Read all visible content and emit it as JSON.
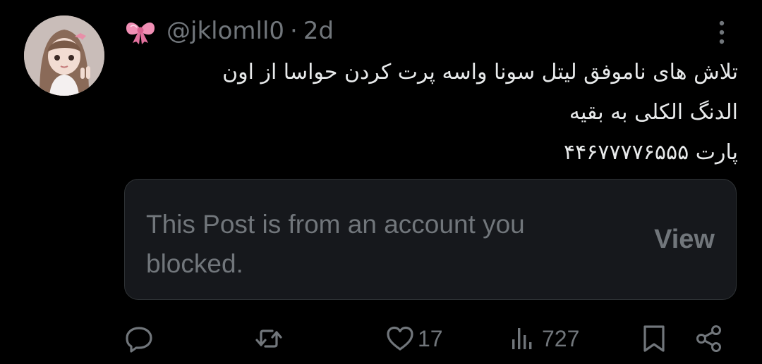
{
  "post": {
    "handle": "@jklomll0",
    "separator": "·",
    "time": "2d",
    "text_lines": [
      "تلاش های ناموفق لیتل سونا واسه پرت کردن حواسا از اون",
      "الدنگ الکلی به بقیه",
      "پارت ۴۴۶۷۷۷۷۶۵۵۵"
    ]
  },
  "quoted": {
    "message": "This Post is from an account you blocked.",
    "view_label": "View"
  },
  "actions": {
    "likes": "17",
    "views": "727"
  },
  "icons": {
    "reply": "reply-icon",
    "retweet": "retweet-icon",
    "like": "heart-icon",
    "views": "views-icon",
    "bookmark": "bookmark-icon",
    "share": "share-icon",
    "more": "more-vertical-icon",
    "badge": "ribbon-bow-icon"
  },
  "colors": {
    "background": "#000000",
    "text": "#e7e9ea",
    "muted": "#71767b",
    "card": "#16181c",
    "bow": "#f18fb5"
  }
}
